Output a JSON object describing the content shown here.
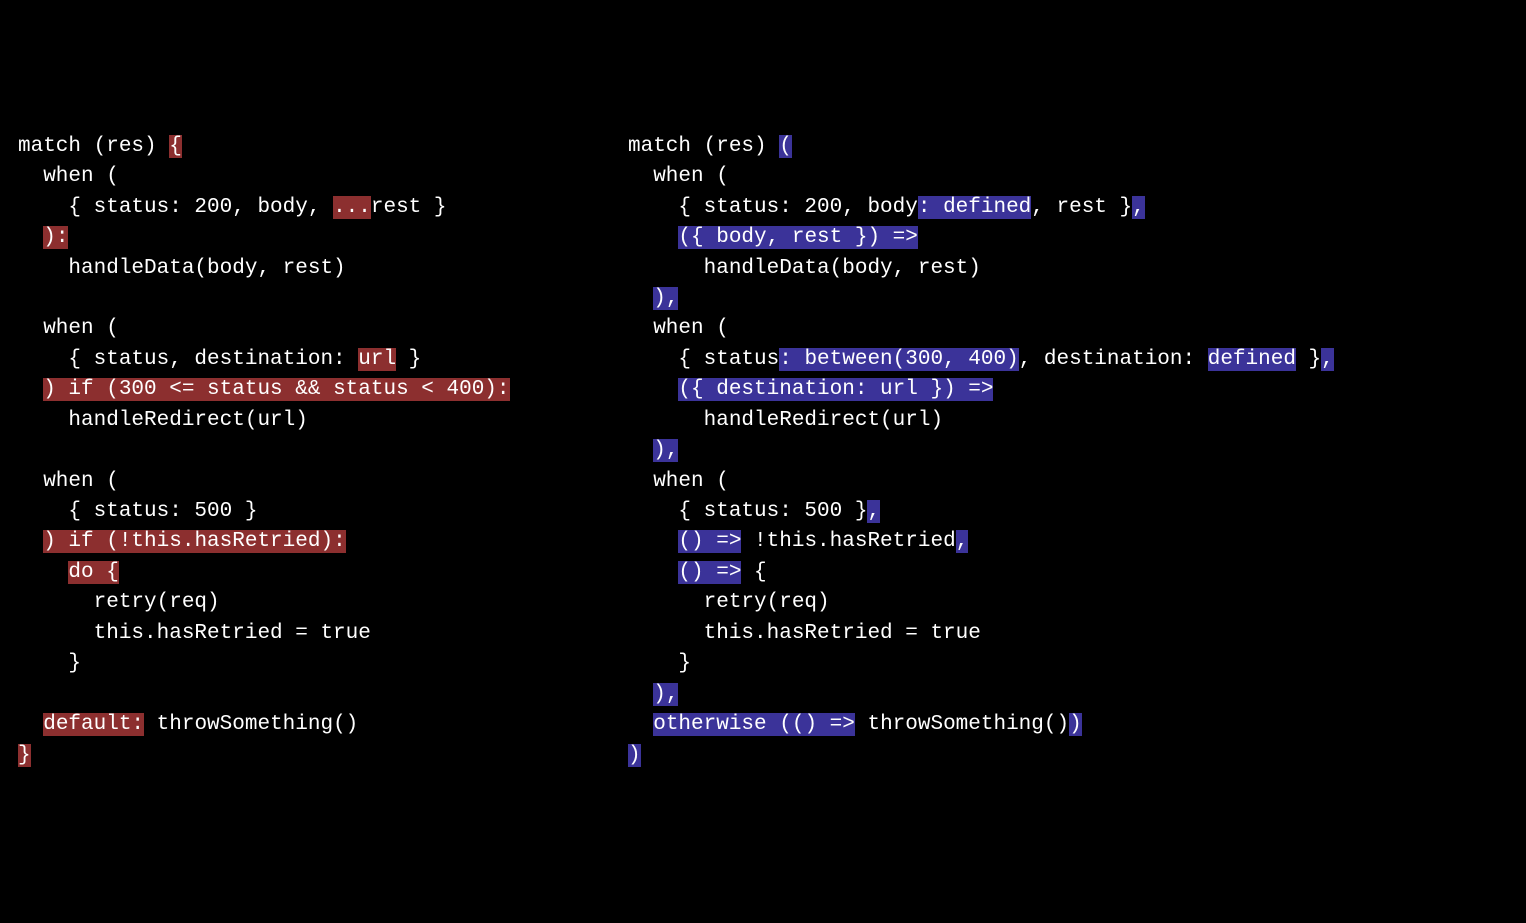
{
  "left": {
    "l1a": "match (res) ",
    "l1b": "{",
    "l2": "  when (",
    "l3a": "    { status: 200, body, ",
    "l3b": "...",
    "l3c": "rest }",
    "l4a": "  ",
    "l4b": "):",
    "l5": "    handleData(body, rest)",
    "l6": "",
    "l7": "  when (",
    "l8a": "    { status, destination: ",
    "l8b": "url",
    "l8c": " }",
    "l9a": "  ",
    "l9b": ") if (300 <= status && status < 400):",
    "l10": "    handleRedirect(url)",
    "l11": "",
    "l12": "  when (",
    "l13": "    { status: 500 }",
    "l14a": "  ",
    "l14b": ") if (!this.hasRetried):",
    "l15a": "    ",
    "l15b": "do {",
    "l16": "      retry(req)",
    "l17": "      this.hasRetried = true",
    "l18": "    }",
    "l19": "",
    "l20a": "  ",
    "l20b": "default:",
    "l20c": " throwSomething()",
    "l21": "}"
  },
  "right": {
    "l1a": "match (res) ",
    "l1b": "(",
    "l2": "  when (",
    "l3a": "    { status: 200, body",
    "l3b": ": defined",
    "l3c": ", rest }",
    "l3d": ",",
    "l4a": "    ",
    "l4b": "({ body, rest }) =>",
    "l5": "      handleData(body, rest)",
    "l6a": "  ",
    "l6b": "),",
    "l7": "  when (",
    "l8a": "    { status",
    "l8b": ": between(300, 400)",
    "l8c": ", destination: ",
    "l8d": "defined",
    "l8e": " }",
    "l8f": ",",
    "l9a": "    ",
    "l9b": "({ destination: url }) =>",
    "l10": "      handleRedirect(url)",
    "l11a": "  ",
    "l11b": "),",
    "l12": "  when (",
    "l13a": "    { status: 500 }",
    "l13b": ",",
    "l14a": "    ",
    "l14b": "() =>",
    "l14c": " !this.hasRetried",
    "l14d": ",",
    "l15a": "    ",
    "l15b": "() =>",
    "l15c": " {",
    "l16": "      retry(req)",
    "l17": "      this.hasRetried = true",
    "l18": "    }",
    "l19a": "  ",
    "l19b": "),",
    "l20a": "  ",
    "l20b": "otherwise (() =>",
    "l20c": " throwSomething()",
    "l20d": ")",
    "l21": ")"
  }
}
